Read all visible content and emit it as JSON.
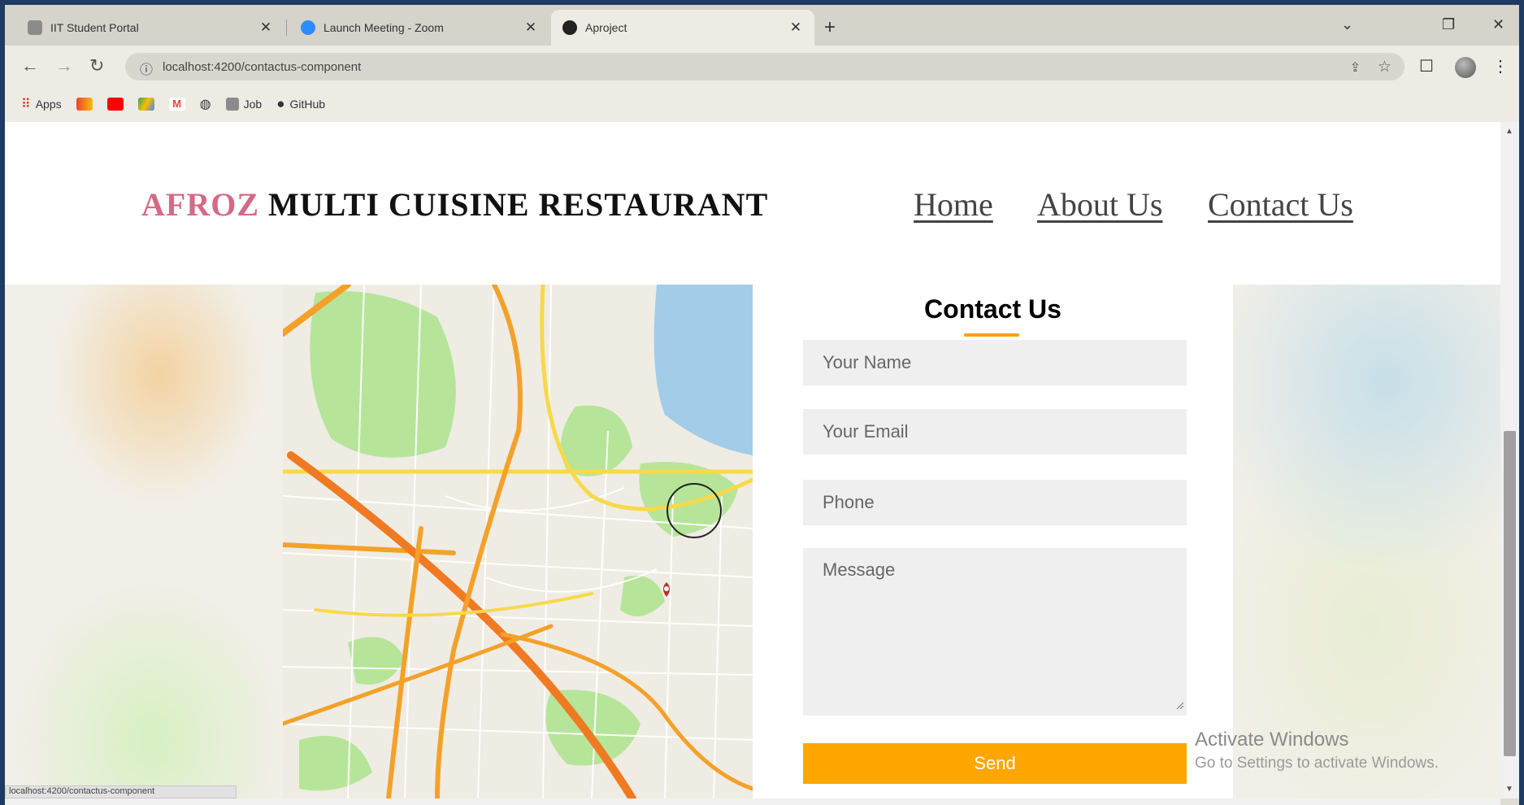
{
  "browser": {
    "tabs": [
      {
        "label": "IIT Student Portal"
      },
      {
        "label": "Launch Meeting - Zoom"
      },
      {
        "label": "Aproject"
      }
    ],
    "new_tab": "+",
    "controls": {
      "minimize": "⌄",
      "restore": "❐",
      "close": "✕"
    },
    "url": "localhost:4200/contactus-component",
    "bookmarks": [
      "Apps",
      "Job",
      "GitHub"
    ],
    "status_url": "localhost:4200/contactus-component"
  },
  "header": {
    "brand_accent": "AFROZ",
    "brand_rest": "MULTI CUISINE RESTAURANT",
    "nav": [
      "Home",
      "About Us",
      "Contact Us"
    ]
  },
  "contact": {
    "title": "Contact Us",
    "name_placeholder": "Your Name",
    "email_placeholder": "Your Email",
    "phone_placeholder": "Phone",
    "message_placeholder": "Message",
    "send_label": "Send"
  },
  "watermark": {
    "line1": "Activate Windows",
    "line2": "Go to Settings to activate Windows."
  },
  "colors": {
    "brand_accent": "#d46a85",
    "send_button": "#ffa600",
    "title_underline": "#f5a300",
    "frame": "#1f3a63"
  }
}
